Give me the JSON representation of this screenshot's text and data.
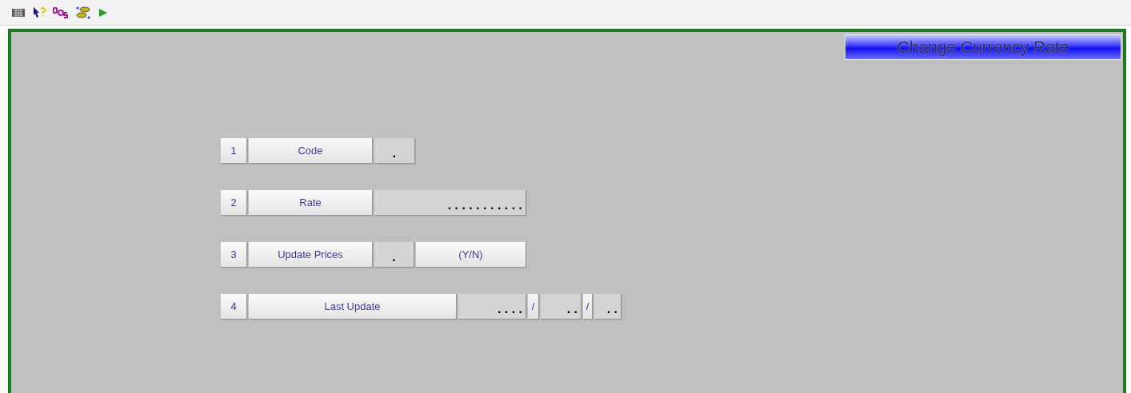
{
  "toolbar": {
    "tools": [
      {
        "kind": "keyboard"
      },
      {
        "kind": "help-pointer"
      },
      {
        "kind": "letters"
      },
      {
        "kind": "database"
      },
      {
        "kind": "run"
      }
    ]
  },
  "form": {
    "title": "Change Currency Rate",
    "rows": [
      {
        "number": "1",
        "label": "Code",
        "segments": [
          {
            "kind": "field",
            "value": "."
          }
        ]
      },
      {
        "number": "2",
        "label": "Rate",
        "segments": [
          {
            "kind": "field",
            "value": ". . . . . . . . . . ."
          }
        ]
      },
      {
        "number": "3",
        "label": "Update Prices",
        "segments": [
          {
            "kind": "field",
            "value": "."
          },
          {
            "kind": "text",
            "value": "(Y/N)"
          }
        ]
      },
      {
        "number": "4",
        "label": "Last Update",
        "segments": [
          {
            "kind": "field",
            "value": ". . . ."
          },
          {
            "kind": "separator",
            "value": "/"
          },
          {
            "kind": "field",
            "value": ". ."
          },
          {
            "kind": "separator",
            "value": "/"
          },
          {
            "kind": "field",
            "value": ". ."
          }
        ]
      }
    ]
  }
}
